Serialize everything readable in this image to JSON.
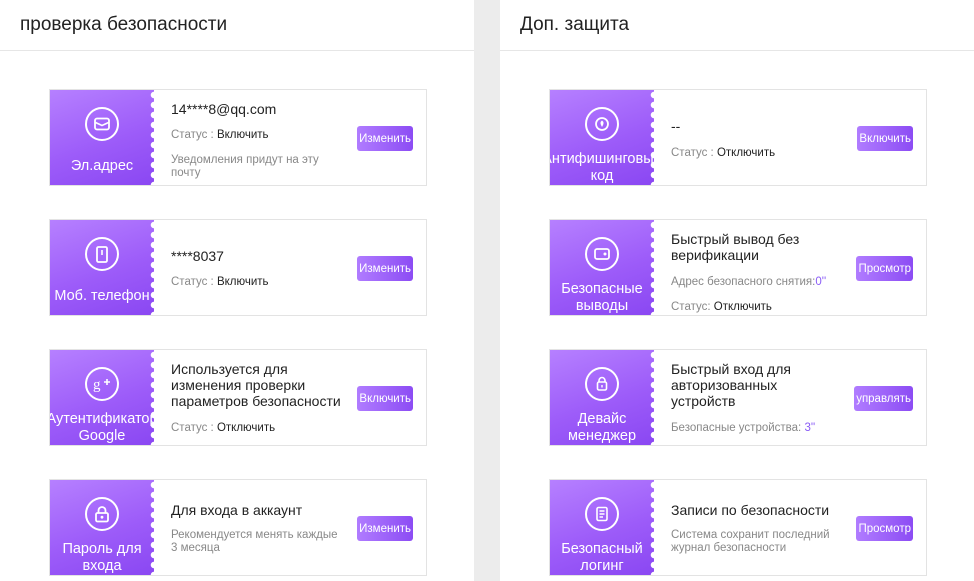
{
  "left_panel": {
    "title": "проверка безопасности",
    "cards": [
      {
        "label": "Эл.адрес",
        "icon": "envelope-icon",
        "value": "14****8@qq.com",
        "status_label": "Статус :",
        "status_value": "Включить",
        "note": "Уведомления придут на эту почту",
        "button": "Изменить"
      },
      {
        "label": "Моб. телефон",
        "icon": "phone-icon",
        "value": "****8037",
        "status_label": "Статус :",
        "status_value": "Включить",
        "button": "Изменить"
      },
      {
        "label_line1": "Аутентификатор",
        "label_line2": "Google",
        "icon": "google-plus-icon",
        "value": "Используется для изменения проверки параметров безопасности",
        "status_label": "Статус :",
        "status_value": "Отключить",
        "button": "Включить"
      },
      {
        "label_line1": "Пароль для",
        "label_line2": "входа",
        "icon": "lock-icon",
        "value": "Для входа в аккаунт",
        "note": "Рекомендуется менять каждые 3 месяца",
        "button": "Изменить"
      }
    ]
  },
  "right_panel": {
    "title": "Доп. защита",
    "cards": [
      {
        "label_line1": "Антифишинговый",
        "label_line2": "код",
        "icon": "shield-icon",
        "value": "--",
        "status_label": "Статус :",
        "status_value": "Отключить",
        "button": "Включить"
      },
      {
        "label_line1": "Безопасные",
        "label_line2": "выводы",
        "icon": "wallet-icon",
        "value": "Быстрый вывод без верификации",
        "note_label": "Адрес безопасного снятия:",
        "note_value": "0''",
        "status_label": "Статус:",
        "status_value": "Отключить",
        "button": "Просмотр"
      },
      {
        "label_line1": "Девайс",
        "label_line2": "менеджер",
        "icon": "device-icon",
        "value": "Быстрый вход для авторизованных устройств",
        "note_label": "Безопасные устройства:",
        "note_value": " 3''",
        "button": "управлять"
      },
      {
        "label_line1": "Безопасный",
        "label_line2": "логинг",
        "icon": "document-icon",
        "value": "Записи по безопасности",
        "note": "Система сохранит последний журнал безопасности",
        "button": "Просмотр"
      }
    ]
  }
}
